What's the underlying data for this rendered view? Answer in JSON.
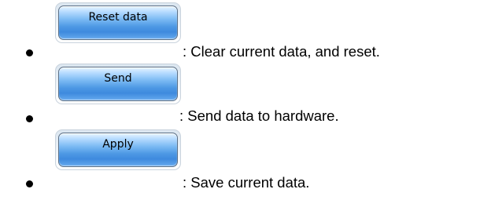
{
  "items": [
    {
      "button_label": "Reset data",
      "description": ": Clear current data, and reset."
    },
    {
      "button_label": "Send",
      "description": ": Send data to hardware."
    },
    {
      "button_label": "Apply",
      "description": ": Save current data."
    }
  ]
}
